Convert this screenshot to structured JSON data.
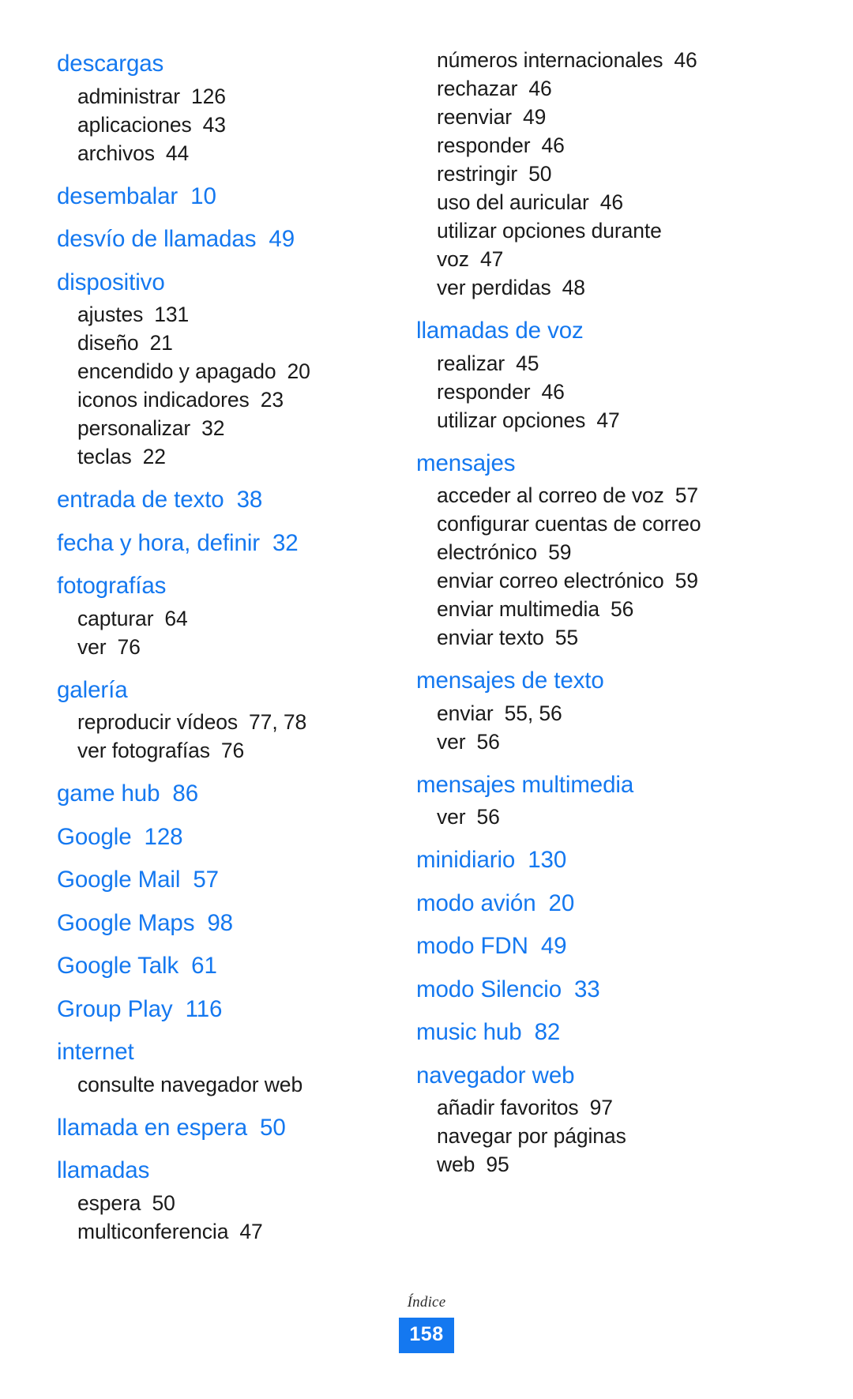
{
  "document": {
    "footer_label": "Índice",
    "page_number": "158",
    "accent_color": "#1478f0",
    "body_color": "#1a1a1a"
  },
  "left_column": [
    {
      "type": "main",
      "label": "descargas",
      "page": ""
    },
    {
      "type": "sub",
      "label": "administrar",
      "page": "126"
    },
    {
      "type": "sub",
      "label": "aplicaciones",
      "page": "43"
    },
    {
      "type": "sub",
      "label": "archivos",
      "page": "44"
    },
    {
      "type": "main",
      "label": "desembalar",
      "page": "10"
    },
    {
      "type": "main",
      "label": "desvío de llamadas",
      "page": "49"
    },
    {
      "type": "main",
      "label": "dispositivo",
      "page": ""
    },
    {
      "type": "sub",
      "label": "ajustes",
      "page": "131"
    },
    {
      "type": "sub",
      "label": "diseño",
      "page": "21"
    },
    {
      "type": "sub",
      "label": "encendido y apagado",
      "page": "20"
    },
    {
      "type": "sub",
      "label": "iconos indicadores",
      "page": "23"
    },
    {
      "type": "sub",
      "label": "personalizar",
      "page": "32"
    },
    {
      "type": "sub",
      "label": "teclas",
      "page": "22"
    },
    {
      "type": "main",
      "label": "entrada de texto",
      "page": "38"
    },
    {
      "type": "main",
      "label": "fecha y hora, definir",
      "page": "32"
    },
    {
      "type": "main",
      "label": "fotografías",
      "page": ""
    },
    {
      "type": "sub",
      "label": "capturar",
      "page": "64"
    },
    {
      "type": "sub",
      "label": "ver",
      "page": "76"
    },
    {
      "type": "main",
      "label": "galería",
      "page": ""
    },
    {
      "type": "sub",
      "label": "reproducir vídeos",
      "page": "77, 78"
    },
    {
      "type": "sub",
      "label": "ver fotografías",
      "page": "76"
    },
    {
      "type": "main",
      "label": "game hub",
      "page": "86"
    },
    {
      "type": "main",
      "label": "Google",
      "page": "128"
    },
    {
      "type": "main",
      "label": "Google Mail",
      "page": "57"
    },
    {
      "type": "main",
      "label": "Google Maps",
      "page": "98"
    },
    {
      "type": "main",
      "label": "Google Talk",
      "page": "61"
    },
    {
      "type": "main",
      "label": "Group Play",
      "page": "116"
    },
    {
      "type": "main",
      "label": "internet",
      "page": ""
    },
    {
      "type": "sub",
      "label": "consulte navegador web",
      "page": ""
    },
    {
      "type": "main",
      "label": "llamada en espera",
      "page": "50"
    },
    {
      "type": "main",
      "label": "llamadas",
      "page": ""
    },
    {
      "type": "sub",
      "label": "espera",
      "page": "50"
    },
    {
      "type": "sub",
      "label": "multiconferencia",
      "page": "47"
    }
  ],
  "right_column": [
    {
      "type": "sub",
      "label": "números internacionales",
      "page": "46"
    },
    {
      "type": "sub",
      "label": "rechazar",
      "page": "46"
    },
    {
      "type": "sub",
      "label": "reenviar",
      "page": "49"
    },
    {
      "type": "sub",
      "label": "responder",
      "page": "46"
    },
    {
      "type": "sub",
      "label": "restringir",
      "page": "50"
    },
    {
      "type": "sub",
      "label": "uso del auricular",
      "page": "46"
    },
    {
      "type": "sub",
      "label": "utilizar opciones durante",
      "page": "",
      "continuation": "voz",
      "continuation_page": "47"
    },
    {
      "type": "sub",
      "label": "ver perdidas",
      "page": "48"
    },
    {
      "type": "main",
      "label": "llamadas de voz",
      "page": ""
    },
    {
      "type": "sub",
      "label": "realizar",
      "page": "45"
    },
    {
      "type": "sub",
      "label": "responder",
      "page": "46"
    },
    {
      "type": "sub",
      "label": "utilizar opciones",
      "page": "47"
    },
    {
      "type": "main",
      "label": "mensajes",
      "page": ""
    },
    {
      "type": "sub",
      "label": "acceder al correo de voz",
      "page": "57"
    },
    {
      "type": "sub",
      "label": "configurar cuentas de correo",
      "page": "",
      "continuation": "electrónico",
      "continuation_page": "59"
    },
    {
      "type": "sub",
      "label": "enviar correo electrónico",
      "page": "59"
    },
    {
      "type": "sub",
      "label": "enviar multimedia",
      "page": "56"
    },
    {
      "type": "sub",
      "label": "enviar texto",
      "page": "55"
    },
    {
      "type": "main",
      "label": "mensajes de texto",
      "page": ""
    },
    {
      "type": "sub",
      "label": "enviar",
      "page": "55, 56"
    },
    {
      "type": "sub",
      "label": "ver",
      "page": "56"
    },
    {
      "type": "main",
      "label": "mensajes multimedia",
      "page": ""
    },
    {
      "type": "sub",
      "label": "ver",
      "page": "56"
    },
    {
      "type": "main",
      "label": "minidiario",
      "page": "130"
    },
    {
      "type": "main",
      "label": "modo avión",
      "page": "20"
    },
    {
      "type": "main",
      "label": "modo FDN",
      "page": "49"
    },
    {
      "type": "main",
      "label": "modo Silencio",
      "page": "33"
    },
    {
      "type": "main",
      "label": "music hub",
      "page": "82"
    },
    {
      "type": "main",
      "label": "navegador web",
      "page": ""
    },
    {
      "type": "sub",
      "label": "añadir favoritos",
      "page": "97"
    },
    {
      "type": "sub",
      "label": "navegar por páginas",
      "page": "",
      "continuation": "web",
      "continuation_page": "95"
    }
  ]
}
